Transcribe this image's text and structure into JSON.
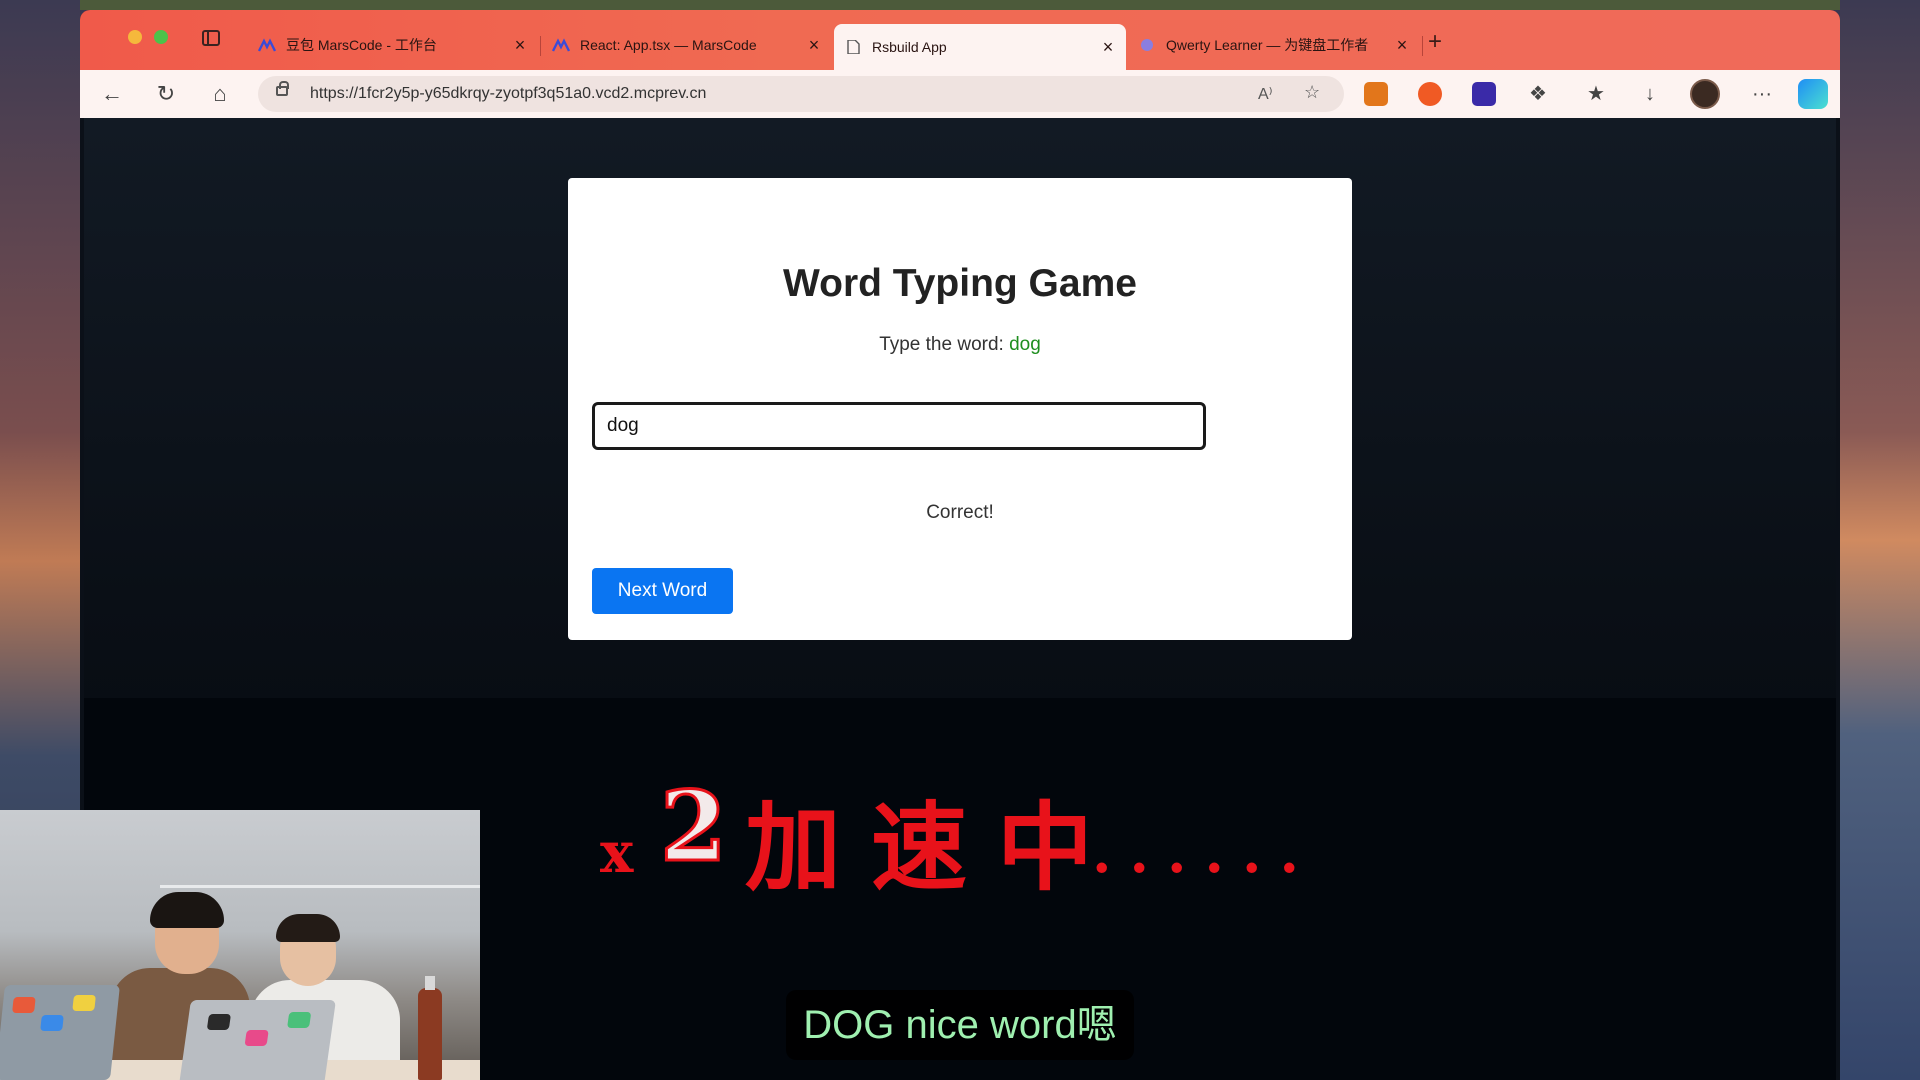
{
  "browser": {
    "tabs": [
      {
        "label": "豆包 MarsCode - 工作台",
        "close": "×",
        "icon": "marscode-icon"
      },
      {
        "label": "React: App.tsx — MarsCode",
        "close": "×",
        "icon": "marscode-icon"
      },
      {
        "label": "Rsbuild App",
        "close": "×",
        "icon": "page-icon",
        "active": true
      },
      {
        "label": "Qwerty Learner — 为键盘工作者",
        "close": "×",
        "icon": "qwerty-icon"
      }
    ],
    "new_tab": "+",
    "url": "https://1fcr2y5p-y65dkrqy-zyotpf3q51a0.vcd2.mcprev.cn",
    "read_aloud": "A⁾",
    "more": "···"
  },
  "app": {
    "title": "Word Typing Game",
    "prompt_prefix": "Type the word: ",
    "target_word": "dog",
    "input_value": "dog",
    "feedback": "Correct!",
    "next_button": "Next Word"
  },
  "overlay": {
    "multiplier_x": "x",
    "multiplier_n": "2",
    "text": "加速中",
    "dots": "......"
  },
  "subtitle": "DOG nice word嗯",
  "colors": {
    "accent_button": "#0a75f2",
    "target_word": "#1e8e1e",
    "overlay_red": "#e8121a",
    "subtitle_text": "#9ff0b0",
    "tabbar": "#f06a52"
  }
}
